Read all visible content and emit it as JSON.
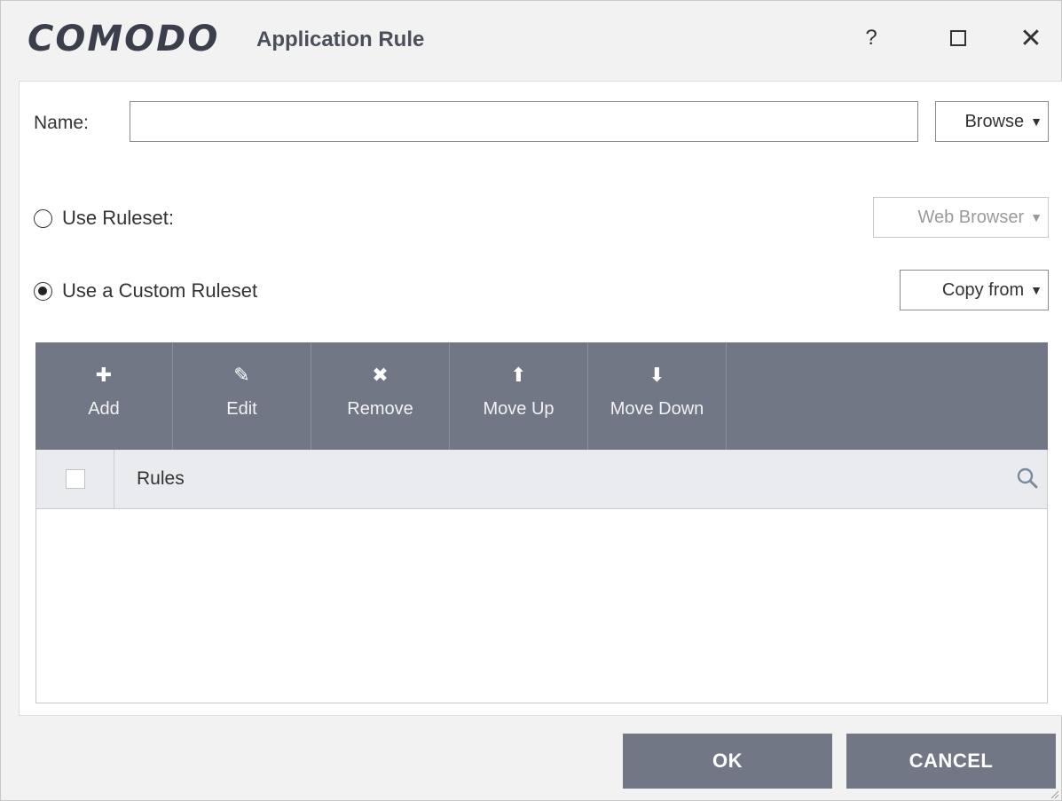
{
  "window": {
    "brand": "COMODO",
    "title": "Application Rule",
    "help_glyph": "?",
    "close_glyph": "✕"
  },
  "form": {
    "name_label": "Name:",
    "name_value": "",
    "name_placeholder": "",
    "browse_label": "Browse",
    "use_ruleset_label": "Use Ruleset:",
    "use_ruleset_checked": false,
    "ruleset_selected": "Web Browser",
    "use_custom_label": "Use a Custom Ruleset",
    "use_custom_checked": true,
    "copy_from_label": "Copy from"
  },
  "toolbar": {
    "items": [
      {
        "label": "Add",
        "icon": "plus-icon",
        "glyph": "✚"
      },
      {
        "label": "Edit",
        "icon": "pencil-icon",
        "glyph": "✎"
      },
      {
        "label": "Remove",
        "icon": "x-icon",
        "glyph": "✖"
      },
      {
        "label": "Move Up",
        "icon": "arrow-up-icon",
        "glyph": "⬆"
      },
      {
        "label": "Move Down",
        "icon": "arrow-down-icon",
        "glyph": "⬇"
      }
    ]
  },
  "table": {
    "column_header": "Rules",
    "rows": []
  },
  "buttons": {
    "ok": "OK",
    "cancel": "CANCEL"
  },
  "colors": {
    "toolbar_bg": "#717785",
    "header_bg": "#e9ebef",
    "button_bg": "#717785"
  }
}
